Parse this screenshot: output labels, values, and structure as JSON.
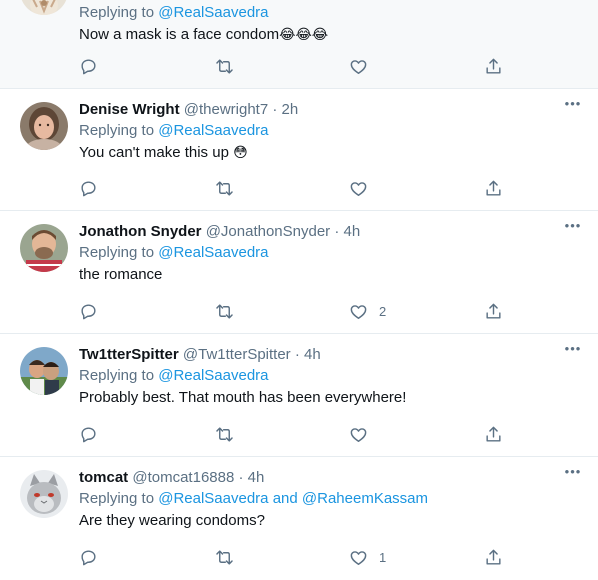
{
  "replies": [
    {
      "name": "",
      "handle": "",
      "time": "",
      "replying_prefix": "Replying to",
      "replying_to": "@RealSaavedra",
      "replying_and": "",
      "replying_to_2": "",
      "text": "Now a mask is a face condom",
      "emoji": "😂😂😂",
      "like_count": "",
      "avatar": "cropped-avatar"
    },
    {
      "name": "Denise Wright",
      "handle": "@thewright7",
      "time": "2h",
      "replying_prefix": "Replying to",
      "replying_to": "@RealSaavedra",
      "text": "You can't make this up",
      "emoji": "😳",
      "like_count": "",
      "avatar": "woman-avatar"
    },
    {
      "name": "Jonathon Snyder",
      "handle": "@JonathonSnyder",
      "time": "4h",
      "replying_prefix": "Replying to",
      "replying_to": "@RealSaavedra",
      "text": "the romance",
      "like_count": "2",
      "avatar": "man-avatar"
    },
    {
      "name": "Tw1tterSpitter",
      "handle": "@Tw1tterSpitter",
      "time": "4h",
      "replying_prefix": "Replying to",
      "replying_to": "@RealSaavedra",
      "text": "Probably best. That mouth has been everywhere!",
      "like_count": "",
      "avatar": "couple-avatar"
    },
    {
      "name": "tomcat",
      "handle": "@tomcat16888",
      "time": "4h",
      "replying_prefix": "Replying to",
      "replying_to": "@RealSaavedra",
      "replying_and": "and",
      "replying_to_2": "@RaheemKassam",
      "text": "Are they wearing condoms?",
      "like_count": "1",
      "avatar": "cat-avatar"
    }
  ],
  "separator_dot": "·",
  "more_glyph": "•••",
  "icons": {
    "reply": "reply-icon",
    "retweet": "retweet-icon",
    "like": "like-icon",
    "share": "share-icon"
  },
  "colors": {
    "link": "#1b95e0",
    "muted": "#5b7083",
    "divider": "#e6ecf0",
    "highlight_bg": "#f7f9fa"
  }
}
